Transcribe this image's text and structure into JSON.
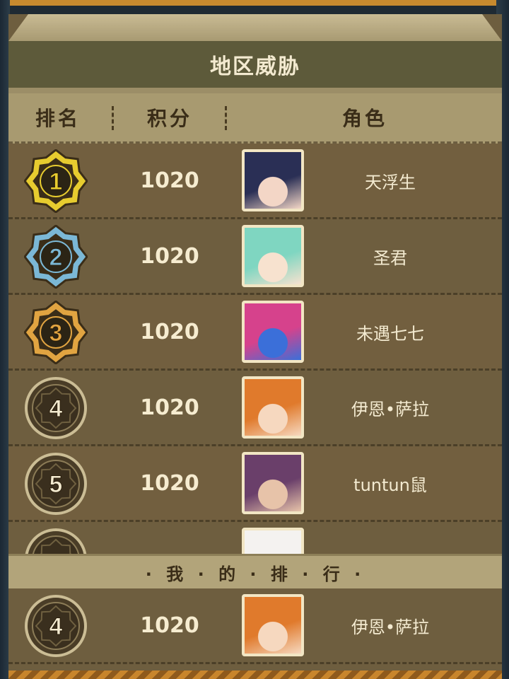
{
  "title": "地区威胁",
  "headers": {
    "rank": "排名",
    "score": "积分",
    "role": "角色"
  },
  "rows": [
    {
      "rank": "1",
      "score": "1020",
      "name": "天浮生",
      "tier": "gold",
      "avatar_colors": [
        "#2a2f55",
        "#f3d6c6"
      ]
    },
    {
      "rank": "2",
      "score": "1020",
      "name": "圣君",
      "tier": "silver",
      "avatar_colors": [
        "#7fd6c1",
        "#f7e2cf"
      ]
    },
    {
      "rank": "3",
      "score": "1020",
      "name": "未遇七七",
      "tier": "bronze",
      "avatar_colors": [
        "#d6428c",
        "#3b6fd9"
      ]
    },
    {
      "rank": "4",
      "score": "1020",
      "name": "伊恩•萨拉",
      "tier": "plain",
      "avatar_colors": [
        "#e07a2c",
        "#f6d8bf"
      ]
    },
    {
      "rank": "5",
      "score": "1020",
      "name": "tuntun鼠",
      "tier": "plain",
      "avatar_colors": [
        "#6a3f6a",
        "#e7c3a9"
      ]
    },
    {
      "rank": "",
      "score": "",
      "name": "",
      "tier": "plain",
      "avatar_colors": [
        "#f4f2f0",
        "#e6b9c6"
      ]
    }
  ],
  "my_rank_label": "· 我 · 的 · 排 · 行 ·",
  "my_rank": {
    "rank": "4",
    "score": "1020",
    "name": "伊恩•萨拉",
    "tier": "plain",
    "avatar_colors": [
      "#e07a2c",
      "#f6d8bf"
    ]
  },
  "colors": {
    "gold": "#e7cc2f",
    "silver": "#7bb8d6",
    "bronze": "#e1a441",
    "plain": "#cbbd95"
  }
}
